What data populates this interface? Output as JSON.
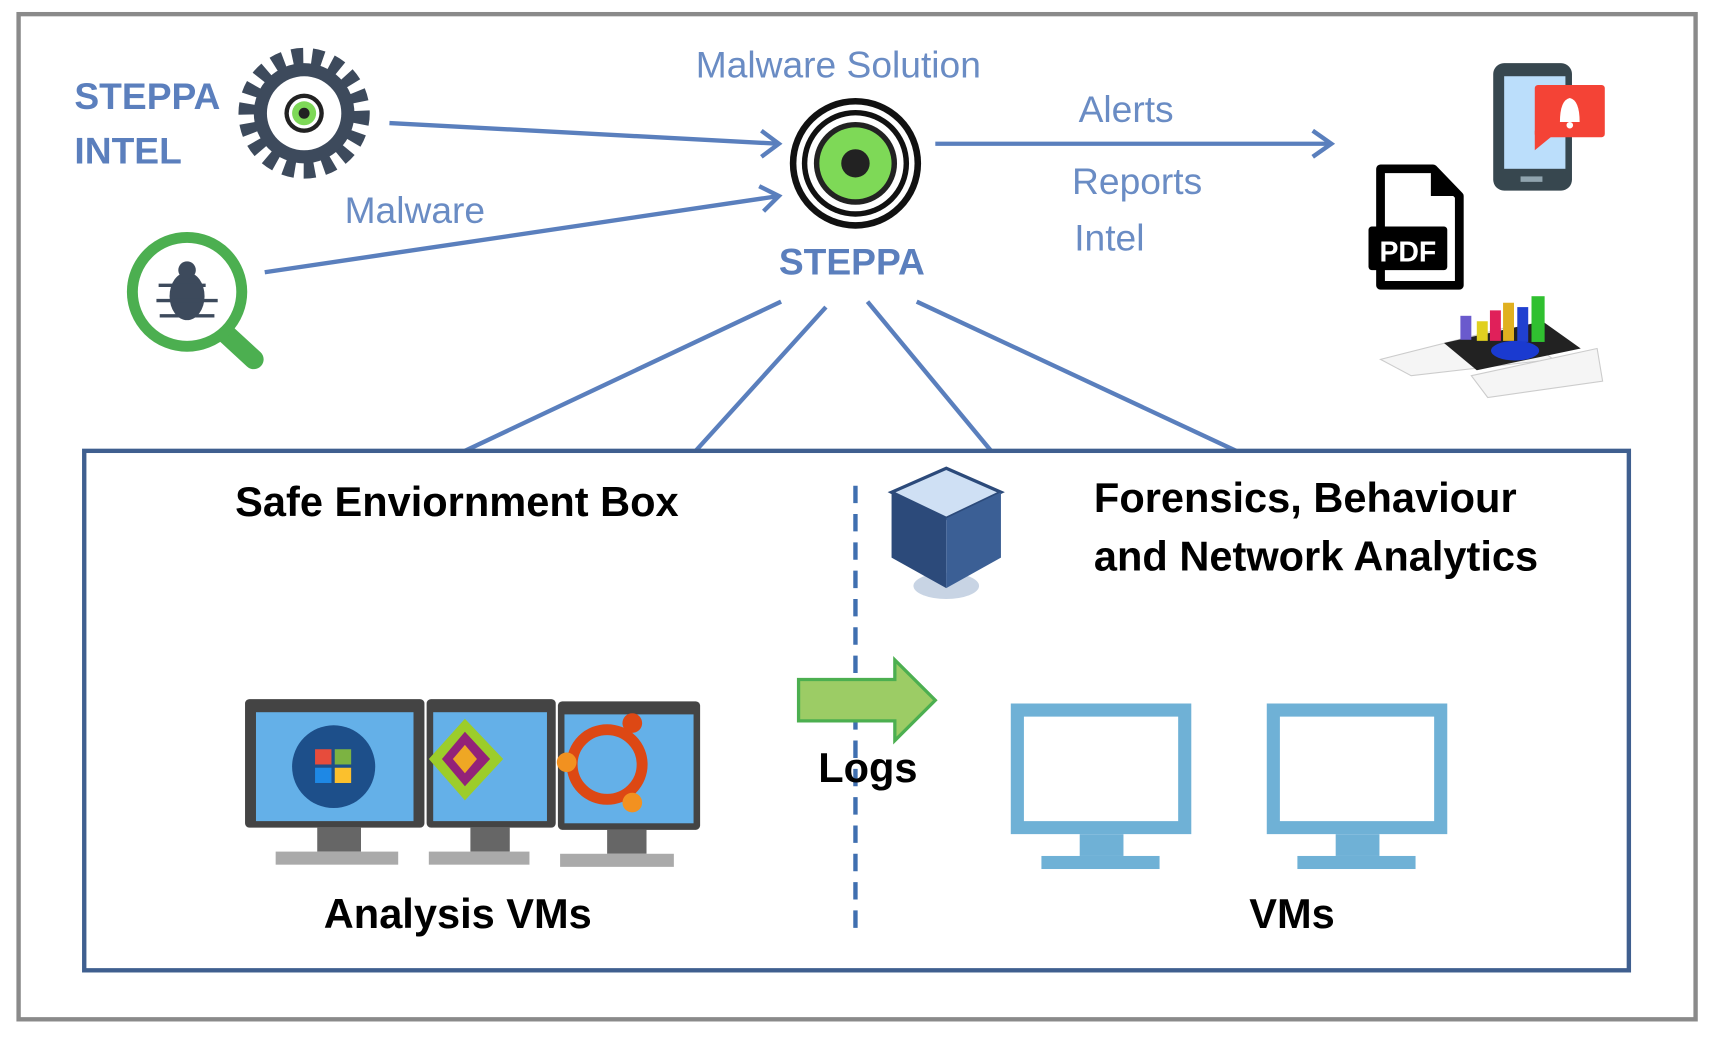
{
  "diagram": {
    "source": {
      "title_line1": "STEPPA",
      "title_line2": "INTEL",
      "malware_label": "Malware"
    },
    "center": {
      "top_label": "Malware Solution",
      "name": "STEPPA"
    },
    "outputs": {
      "alerts": "Alerts",
      "reports": "Reports",
      "intel": "Intel",
      "pdf_label": "PDF"
    },
    "box": {
      "left_title": "Safe Enviornment Box",
      "right_title_line1": "Forensics, Behaviour",
      "right_title_line2": "and Network Analytics",
      "logs_label": "Logs",
      "analysis_vms": "Analysis VMs",
      "vms": "VMs"
    },
    "colors": {
      "line": "#5a7fbd",
      "box_border": "#3f5f8f",
      "green": "#4caf50",
      "monitor_blue": "#6fb1d6",
      "alert_red": "#f44336"
    },
    "icons": [
      "gear-icon",
      "bug-magnifier-icon",
      "target-icon",
      "phone-alert-icon",
      "pdf-file-icon",
      "charts-icon",
      "virtualbox-icon",
      "windows-monitor-icon",
      "centos-monitor-icon",
      "ubuntu-monitor-icon",
      "monitor-icon",
      "arrow-right-icon"
    ]
  }
}
